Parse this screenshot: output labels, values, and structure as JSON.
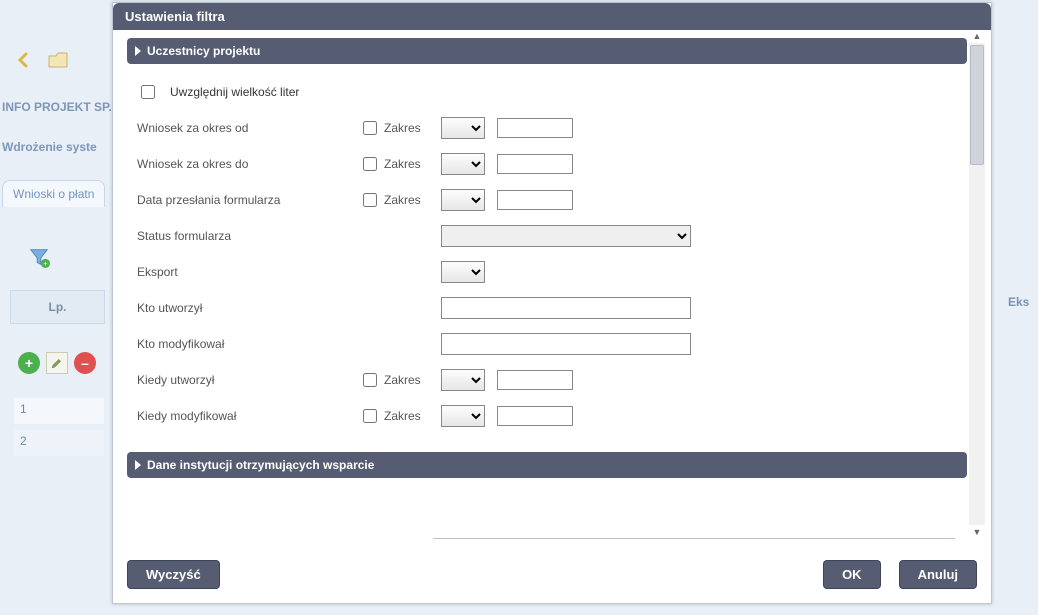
{
  "background": {
    "company": "INFO PROJEKT SP.",
    "subtitle": "Wdrożenie syste",
    "tab_label": "Wnioski o płatn",
    "table_header_lp": "Lp.",
    "table_header_eks": "Eks",
    "row1": "1",
    "row2": "2"
  },
  "dialog": {
    "title": "Ustawienia filtra",
    "section1": "Uczestnicy projektu",
    "section2": "Dane instytucji otrzymujących wsparcie",
    "case_checkbox_label": "Uwzględnij wielkość liter",
    "zakres_label": "Zakres",
    "rows": {
      "wniosek_od": "Wniosek za okres od",
      "wniosek_do": "Wniosek za okres do",
      "data_przeslania": "Data przesłania formularza",
      "status": "Status formularza",
      "eksport": "Eksport",
      "kto_utworzyl": "Kto utworzył",
      "kto_modyfikowal": "Kto modyfikował",
      "kiedy_utworzyl": "Kiedy utworzył",
      "kiedy_modyfikowal": "Kiedy modyfikował"
    },
    "buttons": {
      "clear": "Wyczyść",
      "ok": "OK",
      "cancel": "Anuluj"
    }
  }
}
